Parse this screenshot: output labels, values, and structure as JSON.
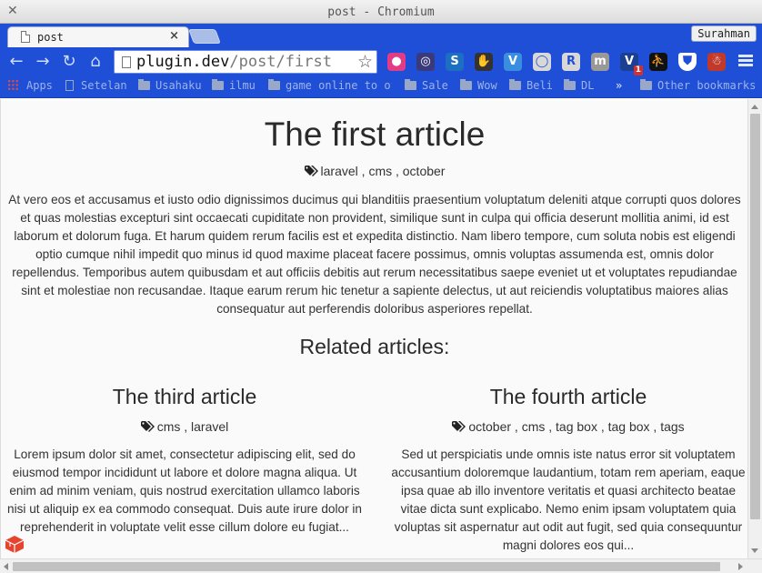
{
  "window": {
    "title": "post - Chromium",
    "close_glyph": "✕"
  },
  "tab": {
    "label": "post",
    "close_glyph": "×",
    "icon": "page-icon"
  },
  "profile": {
    "name": "Surahman"
  },
  "nav": {
    "back": "←",
    "forward": "→",
    "reload": "↻",
    "home": "⌂"
  },
  "omnibox": {
    "host": "plugin.dev",
    "path": "/post/first",
    "star": "☆"
  },
  "extensions": [
    {
      "name": "color-wheel-icon",
      "glyph": "●",
      "color": "#e33c87"
    },
    {
      "name": "disc-icon",
      "glyph": "◎",
      "color": "#3a3a7a"
    },
    {
      "name": "s-logo-icon",
      "glyph": "S",
      "color": "#1d6fc2"
    },
    {
      "name": "hand-icon",
      "glyph": "✋",
      "color": "#333333"
    },
    {
      "name": "v-circle-icon",
      "glyph": "V",
      "color": "#3a8ee0"
    },
    {
      "name": "ring-icon",
      "glyph": "◯",
      "color": "#d8d8d8"
    },
    {
      "name": "r-logo-icon",
      "glyph": "R",
      "color": "#d8d8d8"
    },
    {
      "name": "m-circle-icon",
      "glyph": "m",
      "color": "#999999"
    },
    {
      "name": "vpn-shield-icon",
      "glyph": "V",
      "color": "#1b3f91",
      "badge": "1"
    },
    {
      "name": "runner-icon",
      "glyph": "⛹",
      "color": "#111111"
    },
    {
      "name": "shield-icon",
      "glyph": "⛊",
      "color": "#ffffff"
    },
    {
      "name": "santa-icon",
      "glyph": "☃",
      "color": "#c0392b"
    }
  ],
  "bookmarks": [
    {
      "label": "Apps",
      "icon": "apps-grid-icon"
    },
    {
      "label": "Setelan",
      "icon": "page-icon"
    },
    {
      "label": "Usahaku",
      "icon": "folder-icon"
    },
    {
      "label": "ilmu",
      "icon": "folder-icon"
    },
    {
      "label": "game online to of",
      "icon": "folder-icon"
    },
    {
      "label": "Sale",
      "icon": "folder-icon"
    },
    {
      "label": "Wow",
      "icon": "folder-icon"
    },
    {
      "label": "Beli",
      "icon": "folder-icon"
    },
    {
      "label": "DL",
      "icon": "folder-icon"
    }
  ],
  "bookmarks_overflow": "»",
  "other_bookmarks": "Other bookmarks",
  "article": {
    "title": "The first article",
    "tags": "laravel , cms , october",
    "body": "At vero eos et accusamus et iusto odio dignissimos ducimus qui blanditiis praesentium voluptatum deleniti atque corrupti quos dolores et quas molestias excepturi sint occaecati cupiditate non provident, similique sunt in culpa qui officia deserunt mollitia animi, id est laborum et dolorum fuga. Et harum quidem rerum facilis est et expedita distinctio. Nam libero tempore, cum soluta nobis est eligendi optio cumque nihil impedit quo minus id quod maxime placeat facere possimus, omnis voluptas assumenda est, omnis dolor repellendus. Temporibus autem quibusdam et aut officiis debitis aut rerum necessitatibus saepe eveniet ut et voluptates repudiandae sint et molestiae non recusandae. Itaque earum rerum hic tenetur a sapiente delectus, ut aut reiciendis voluptatibus maiores alias consequatur aut perferendis doloribus asperiores repellat."
  },
  "related": {
    "heading": "Related articles:",
    "items": [
      {
        "title": "The third article",
        "tags": "cms , laravel",
        "excerpt": "Lorem ipsum dolor sit amet, consectetur adipiscing elit, sed do eiusmod tempor incididunt ut labore et dolore magna aliqua. Ut enim ad minim veniam, quis nostrud exercitation ullamco laboris nisi ut aliquip ex ea commodo consequat. Duis aute irure dolor in reprehenderit in voluptate velit esse cillum dolore eu fugiat..."
      },
      {
        "title": "The fourth article",
        "tags": "october , cms , tag box , tag box , tags",
        "excerpt": "Sed ut perspiciatis unde omnis iste natus error sit voluptatem accusantium doloremque laudantium, totam rem aperiam, eaque ipsa quae ab illo inventore veritatis et quasi architecto beatae vitae dicta sunt explicabo. Nemo enim ipsam voluptatem quia voluptas sit aspernatur aut odit aut fugit, sed quia consequuntur magni dolores eos qui..."
      }
    ]
  },
  "colors": {
    "chrome_blue": "#1e4fd6",
    "page_bg": "#fafafa",
    "text": "#333333",
    "laravel_red": "#e74430"
  }
}
